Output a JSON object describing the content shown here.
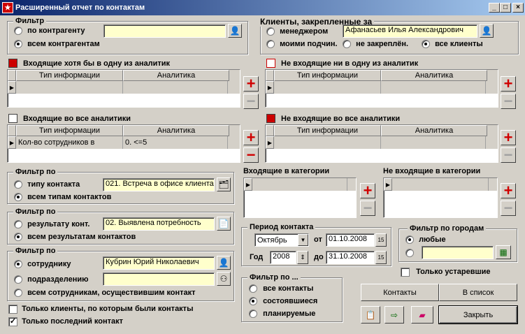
{
  "window": {
    "title": "Расширенный отчет по контактам",
    "min": "_",
    "max": "□",
    "close": "×"
  },
  "filter": {
    "legend": "Фильтр",
    "opt1": "по контрагенту",
    "opt2": "всем контрагентам",
    "value": ""
  },
  "clients": {
    "legend": "Клиенты, закрепленные за",
    "manager": "менеджером",
    "manager_value": "Афанасьев Илья Александрович",
    "subord": "моими подчин.",
    "not_assigned": "не закреплён.",
    "all": "все клиенты"
  },
  "sections": {
    "in_any": "Входящие хотя бы в одну из аналитик",
    "not_in_any": "Не входящие ни в одну из аналитик",
    "in_all": "Входящие во все аналитики",
    "not_in_all": "Не входящие во все аналитики"
  },
  "grid_headers": {
    "col1": "Тип информации",
    "col2": "Аналитика"
  },
  "in_all_row": {
    "type": "Кол-во сотрудников в",
    "analytic": "0. <=5"
  },
  "contact_type": {
    "legend": "Фильтр по",
    "opt1": "типу контакта",
    "value": "021. Встреча в офисе клиента",
    "opt2": "всем типам контактов"
  },
  "result": {
    "legend": "Фильтр по",
    "opt1": "результату конт.",
    "value": "02. Выявлена потребность",
    "opt2": "всем результатам контактов"
  },
  "employee": {
    "legend": "Фильтр по",
    "opt1": "сотруднику",
    "value": "Кубрин Юрий Николаевич",
    "opt2": "подразделению",
    "dept_value": "",
    "opt3": "всем сотрудникам, осуществившим контакт"
  },
  "checks": {
    "only_clients": "Только клиенты, по которым были контакты",
    "only_last": "Только последний контакт"
  },
  "categories": {
    "in": "Входящие в категории",
    "not_in": "Не входящие в категории"
  },
  "period": {
    "legend": "Период контакта",
    "month": "Октябрь",
    "from_label": "от",
    "from": "01.10.2008",
    "year_label": "Год",
    "year": "2008",
    "to_label": "до",
    "to": "31.10.2008"
  },
  "city": {
    "legend": "Фильтр по городам",
    "any": "любые",
    "value": ""
  },
  "outdated": "Только устаревшие",
  "filter_by": {
    "legend": "Фильтр по ...",
    "all": "все контакты",
    "done": "состоявшиеся",
    "planned": "планируемые"
  },
  "buttons": {
    "contacts": "Контакты",
    "to_list": "В список",
    "close": "Закрыть"
  }
}
